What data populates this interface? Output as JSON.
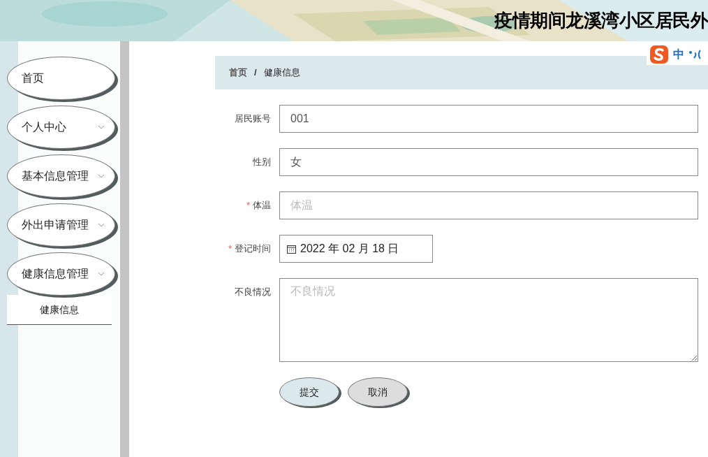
{
  "header": {
    "title": "疫情期间龙溪湾小区居民外"
  },
  "ime": {
    "mode": "中"
  },
  "sidebar": {
    "items": [
      {
        "label": "首页",
        "has_children": false
      },
      {
        "label": "个人中心",
        "has_children": true,
        "expanded": false
      },
      {
        "label": "基本信息管理",
        "has_children": true,
        "expanded": false
      },
      {
        "label": "外出申请管理",
        "has_children": true,
        "expanded": false
      },
      {
        "label": "健康信息管理",
        "has_children": true,
        "expanded": true,
        "children": [
          {
            "label": "健康信息"
          }
        ]
      }
    ]
  },
  "breadcrumb": [
    {
      "label": "首页"
    },
    {
      "label": "健康信息"
    }
  ],
  "breadcrumb_separator": "/",
  "form": {
    "required_mark": "*",
    "fields": [
      {
        "kind": "text",
        "label": "居民账号",
        "required": false,
        "value": "001"
      },
      {
        "kind": "text",
        "label": "性别",
        "required": false,
        "value": "女"
      },
      {
        "kind": "text",
        "label": "体温",
        "required": true,
        "placeholder": "体温"
      },
      {
        "kind": "date",
        "label": "登记时间",
        "required": true,
        "value": "2022 年 02 月 18 日"
      },
      {
        "kind": "textarea",
        "label": "不良情况",
        "required": false,
        "placeholder": "不良情况"
      }
    ],
    "buttons": [
      {
        "label": "提交",
        "kind": "primary"
      },
      {
        "label": "取消",
        "kind": "secondary"
      }
    ]
  }
}
